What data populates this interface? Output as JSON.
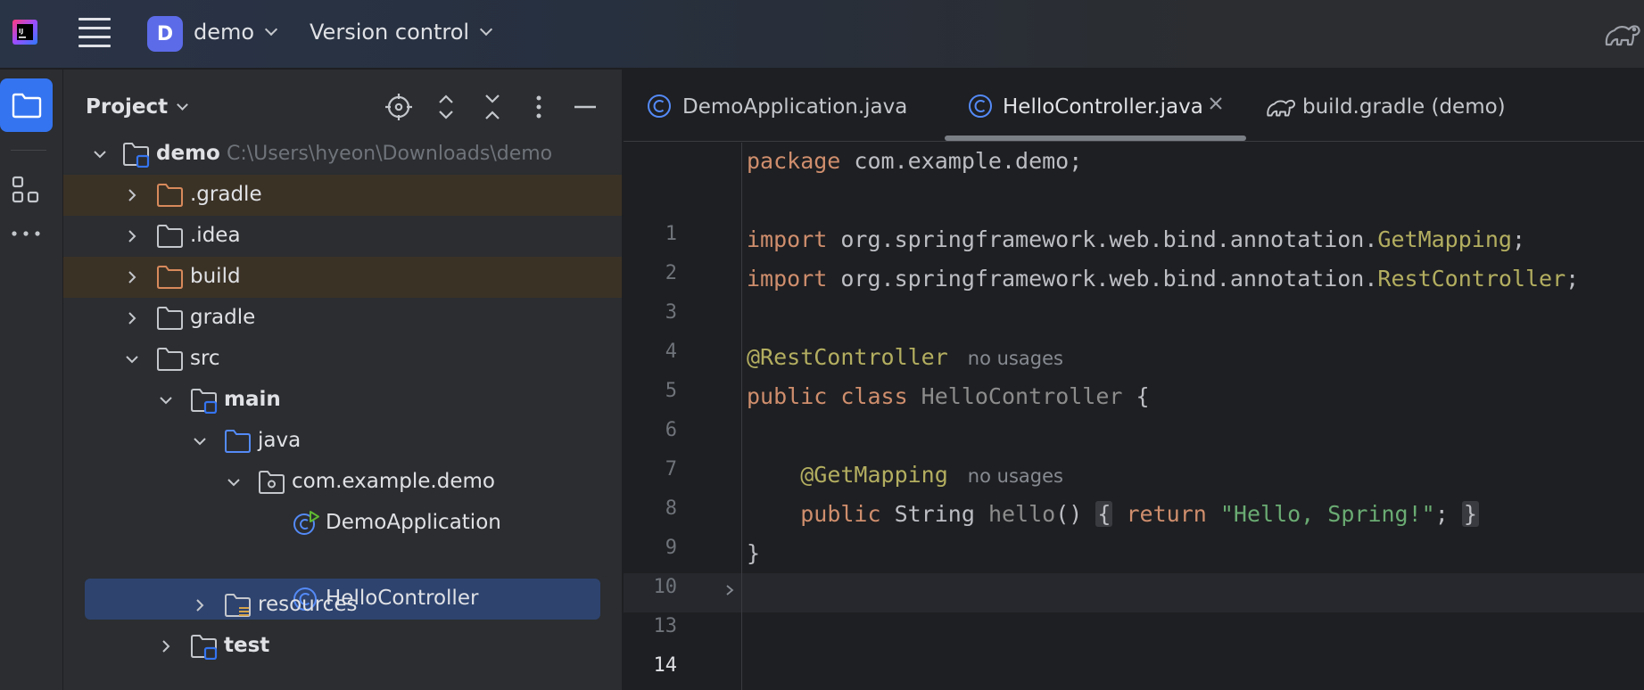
{
  "topbar": {
    "project_initial": "D",
    "project_name": "demo",
    "vcs_label": "Version control"
  },
  "project_panel": {
    "title": "Project",
    "tree": [
      {
        "label": "demo",
        "path": "C:\\Users\\hyeon\\Downloads\\demo",
        "bold": true,
        "expanded": true
      },
      {
        "label": ".gradle",
        "expanded": false,
        "highlight": "excluded"
      },
      {
        "label": ".idea",
        "expanded": false
      },
      {
        "label": "build",
        "expanded": false,
        "highlight": "excluded"
      },
      {
        "label": "gradle",
        "expanded": false
      },
      {
        "label": "src",
        "expanded": true
      },
      {
        "label": "main",
        "bold": true,
        "expanded": true
      },
      {
        "label": "java",
        "expanded": true
      },
      {
        "label": "com.example.demo",
        "expanded": true
      },
      {
        "label": "DemoApplication"
      },
      {
        "label": "HelloController",
        "selected": true
      },
      {
        "label": "resources",
        "expanded": false
      },
      {
        "label": "test",
        "bold": true,
        "expanded": false
      }
    ]
  },
  "editor": {
    "tabs": [
      {
        "label": "DemoApplication.java",
        "icon": "java-class-icon"
      },
      {
        "label": "HelloController.java",
        "icon": "java-class-icon",
        "active": true
      },
      {
        "label": "build.gradle (demo)",
        "icon": "gradle-elephant-icon"
      }
    ],
    "line_numbers": [
      "1",
      "2",
      "3",
      "4",
      "5",
      "6",
      "7",
      "8",
      "9",
      "10",
      "13",
      "14"
    ],
    "current_line": "14",
    "code": {
      "l1_kw": "package",
      "l1_rest": " com.example.demo;",
      "l3_kw": "import",
      "l3_pkg": " org.springframework.web.bind.annotation.",
      "l3_cls": "GetMapping",
      "l3_end": ";",
      "l4_kw": "import",
      "l4_pkg": " org.springframework.web.bind.annotation.",
      "l4_cls": "RestController",
      "l4_end": ";",
      "l6_ann": "@RestController",
      "l6_hint": "no usages",
      "l7_kw": "public class",
      "l7_name": " HelloController",
      "l7_brace": " {",
      "l9_ann": "@GetMapping",
      "l9_hint": "no usages",
      "l10_kw": "public",
      "l10_type": " String",
      "l10_name": " hello",
      "l10_parens": "()",
      "l10_open": "{",
      "l10_ret": "return",
      "l10_str": "\"Hello, Spring!\"",
      "l10_semi": ";",
      "l10_close": "}",
      "l13_brace": "}"
    }
  },
  "colors": {
    "accent": "#3574f0",
    "project_badge": "#5c6be8",
    "selection": "#2e436e",
    "excluded_row": "#3b3226",
    "keyword": "#cf8e6d",
    "annotation": "#b3ae60",
    "string": "#6aab73"
  }
}
